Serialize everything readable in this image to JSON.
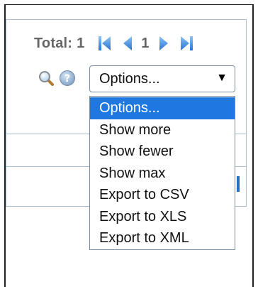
{
  "pager": {
    "total_label": "Total:",
    "total_value": "1",
    "current_page": "1"
  },
  "icons": {
    "first": "first-page-icon",
    "prev": "previous-page-icon",
    "next": "next-page-icon",
    "last": "last-page-icon",
    "search": "search-icon",
    "help": "help-icon"
  },
  "options_select": {
    "selected_value": "Options...",
    "options": [
      "Options...",
      "Show more",
      "Show fewer",
      "Show max",
      "Export to CSV",
      "Export to XLS",
      "Export to XML"
    ]
  },
  "colors": {
    "accent": "#1e78e0",
    "pager_icon": "#3b8de0",
    "panel_border": "#a9bfd6",
    "text_gray": "#666666"
  }
}
